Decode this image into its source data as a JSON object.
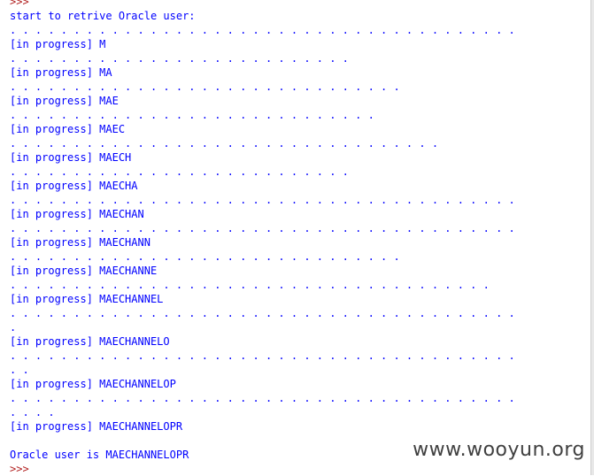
{
  "console": {
    "top_prompt": ">>>",
    "start_text": "start to retrive Oracle user:",
    "progress_prefix": "[in progress]",
    "rows": [
      {
        "dots": 40,
        "progress": "M"
      },
      {
        "dots": 27,
        "progress": "MA"
      },
      {
        "dots": 31,
        "progress": "MAE"
      },
      {
        "dots": 29,
        "progress": "MAEC"
      },
      {
        "dots": 34,
        "progress": "MAECH"
      },
      {
        "dots": 27,
        "progress": "MAECHA"
      },
      {
        "dots": 40,
        "progress": "MAECHAN"
      },
      {
        "dots": 40,
        "progress": "MAECHANN"
      },
      {
        "dots": 31,
        "progress": "MAECHANNE"
      },
      {
        "dots": 38,
        "progress": "MAECHANNEL"
      },
      {
        "dots": 40,
        "wrap_dots": 1,
        "progress": "MAECHANNELO"
      },
      {
        "dots": 40,
        "wrap_dots": 2,
        "progress": "MAECHANNELOP"
      },
      {
        "dots": 40,
        "wrap_dots": 4,
        "progress": "MAECHANNELOPR"
      }
    ],
    "result_text": "Oracle user is MAECHANNELOPR",
    "bottom_prompt": ">>>"
  },
  "watermark": "www.wooyun.org",
  "colors": {
    "output_text": "#0000ff",
    "prompt": "#b22222",
    "background": "#ffffff"
  }
}
